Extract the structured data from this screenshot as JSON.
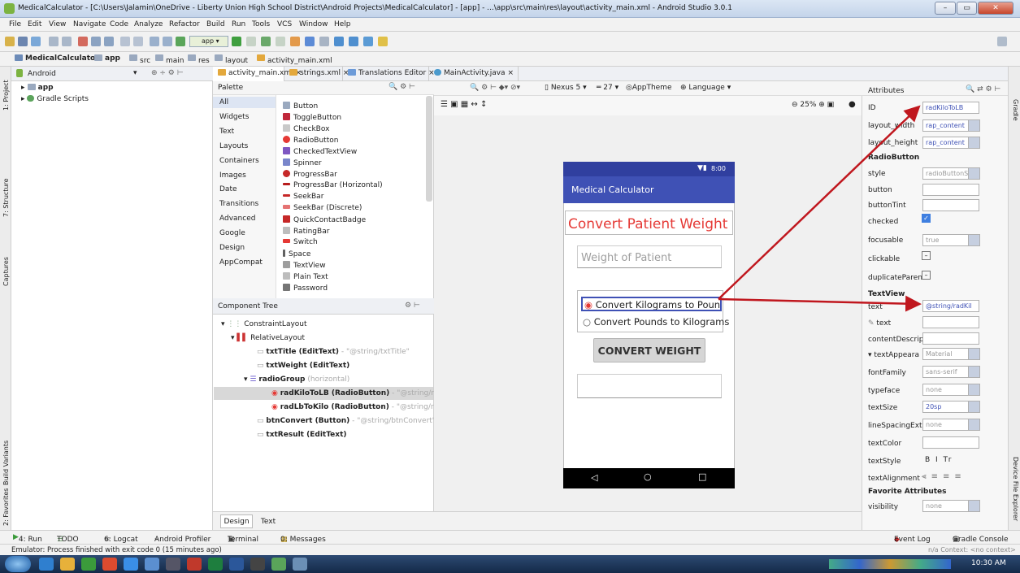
{
  "window": {
    "title": "MedicalCalculator - [C:\\Users\\Jalamin\\OneDrive - Liberty Union High School District\\Android Projects\\MedicalCalculator] - [app] - ...\\app\\src\\main\\res\\layout\\activity_main.xml - Android Studio 3.0.1"
  },
  "menu": [
    "File",
    "Edit",
    "View",
    "Navigate",
    "Code",
    "Analyze",
    "Refactor",
    "Build",
    "Run",
    "Tools",
    "VCS",
    "Window",
    "Help"
  ],
  "toolbar": {
    "run_config": "app"
  },
  "breadcrumb": [
    "MedicalCalculator",
    "app",
    "src",
    "main",
    "res",
    "layout",
    "activity_main.xml"
  ],
  "project": {
    "view_mode": "Android",
    "items": [
      "app",
      "Gradle Scripts"
    ]
  },
  "left_strip": [
    "1: Project",
    "7: Structure",
    "Captures",
    "Build Variants",
    "2: Favorites"
  ],
  "right_strip": [
    "Gradle",
    "Device File Explorer"
  ],
  "editor_tabs": [
    "activity_main.xml",
    "strings.xml",
    "Translations Editor",
    "MainActivity.java"
  ],
  "palette": {
    "title": "Palette",
    "categories": [
      "All",
      "Widgets",
      "Text",
      "Layouts",
      "Containers",
      "Images",
      "Date",
      "Transitions",
      "Advanced",
      "Google",
      "Design",
      "AppCompat"
    ],
    "items": [
      "Button",
      "ToggleButton",
      "CheckBox",
      "RadioButton",
      "CheckedTextView",
      "Spinner",
      "ProgressBar",
      "ProgressBar (Horizontal)",
      "SeekBar",
      "SeekBar (Discrete)",
      "QuickContactBadge",
      "RatingBar",
      "Switch",
      "Space",
      "TextView",
      "Plain Text",
      "Password"
    ]
  },
  "design_toolbar": {
    "device": "Nexus 5",
    "api": "27",
    "theme": "AppTheme",
    "language": "Language",
    "zoom": "25%"
  },
  "tree": {
    "title": "Component Tree",
    "nodes": [
      {
        "name": "ConstraintLayout",
        "detail": ""
      },
      {
        "name": "RelativeLayout",
        "detail": ""
      },
      {
        "name": "txtTitle (EditText)",
        "detail": "- \"@string/txtTitle\""
      },
      {
        "name": "txtWeight (EditText)",
        "detail": ""
      },
      {
        "name": "radioGroup",
        "detail": "(horizontal)"
      },
      {
        "name": "radKiloToLB (RadioButton)",
        "detail": "- \"@string/radKilo"
      },
      {
        "name": "radLbToKilo (RadioButton)",
        "detail": "- \"@string/radLbT"
      },
      {
        "name": "btnConvert (Button)",
        "detail": "- \"@string/btnConvert\""
      },
      {
        "name": "txtResult (EditText)",
        "detail": ""
      }
    ]
  },
  "phone": {
    "time": "8:00",
    "app_title": "Medical Calculator",
    "header": "Convert Patient Weight",
    "weight_hint": "Weight of Patient",
    "radio1": "Convert Kilograms to Pounds",
    "radio2": "Convert Pounds to Kilograms",
    "button": "CONVERT WEIGHT"
  },
  "attributes": {
    "title": "Attributes",
    "rows": [
      {
        "name": "ID",
        "value": "radKiloToLB"
      },
      {
        "name": "layout_width",
        "value": "rap_content"
      },
      {
        "name": "layout_height",
        "value": "rap_content"
      }
    ],
    "section_radio": "RadioButton",
    "radio_rows": [
      {
        "name": "style",
        "value": "radioButtonS"
      },
      {
        "name": "button",
        "value": ""
      },
      {
        "name": "buttonTint",
        "value": ""
      },
      {
        "name": "checked",
        "value": ""
      },
      {
        "name": "focusable",
        "value": "true"
      },
      {
        "name": "clickable",
        "value": ""
      },
      {
        "name": "duplicateParen",
        "value": ""
      }
    ],
    "section_text": "TextView",
    "text_rows": [
      {
        "name": "text",
        "value": "@string/radKil"
      },
      {
        "name": "text",
        "value": ""
      },
      {
        "name": "contentDescrip",
        "value": ""
      },
      {
        "name": "textAppeara",
        "value": "Material"
      },
      {
        "name": "fontFamily",
        "value": "sans-serif"
      },
      {
        "name": "typeface",
        "value": "none"
      },
      {
        "name": "textSize",
        "value": "20sp"
      },
      {
        "name": "lineSpacingExtr",
        "value": "none"
      },
      {
        "name": "textColor",
        "value": ""
      },
      {
        "name": "textStyle",
        "value": "B  I  Tr"
      },
      {
        "name": "textAlignment",
        "value": ""
      }
    ],
    "section_fav": "Favorite Attributes",
    "fav_rows": [
      {
        "name": "visibility",
        "value": "none"
      }
    ]
  },
  "bottom_tabs": [
    "Design",
    "Text"
  ],
  "tool_windows": [
    "4: Run",
    "TODO",
    "6: Logcat",
    "Android Profiler",
    "Terminal",
    "0: Messages"
  ],
  "tool_right": [
    "Event Log",
    "Gradle Console"
  ],
  "status": {
    "message": "Emulator: Process finished with exit code 0 (15 minutes ago)",
    "right": "n/a  Context: <no context>"
  },
  "taskbar": {
    "time": "10:30 AM"
  },
  "colors": {
    "accent": "#3f51b5",
    "arrow": "#c0171e",
    "title_red": "#e53935"
  }
}
